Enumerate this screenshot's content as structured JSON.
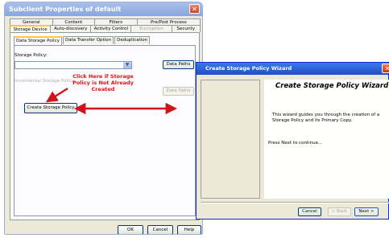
{
  "subclient_window": {
    "title": "Subclient Properties of default",
    "tabs_row1": [
      "General",
      "Content",
      "Filters",
      "Pre/Post Process"
    ],
    "tabs_row2": [
      "Storage Device",
      "Auto-discovery",
      "Activity Control",
      "Encryption",
      "Security"
    ],
    "subtabs": [
      "Data Storage Policy",
      "Data Transfer Option",
      "Deduplication"
    ],
    "storage_policy_label": "Storage Policy:",
    "storage_policy_value": "",
    "incremental_label": "Incremental Storage Policy:",
    "data_paths_label": "Data Paths",
    "data_paths_label_2": "Data Paths",
    "create_button": "Create Storage Policy",
    "ok_button": "OK",
    "cancel_button": "Cancel",
    "help_button": "Help"
  },
  "annotation": {
    "text": "Click Here if Storage Policy is Not Already Created",
    "color": "#e3121a"
  },
  "wizard": {
    "title": "Create Storage Policy Wizard",
    "heading": "Create Storage Policy Wizard",
    "description": "This wizard guides you through the creation of a Storage Policy and its Primary Copy.",
    "press_next": "Press Next to continue...",
    "cancel_button": "Cancel",
    "back_button": "< Back",
    "next_button": "Next >"
  }
}
